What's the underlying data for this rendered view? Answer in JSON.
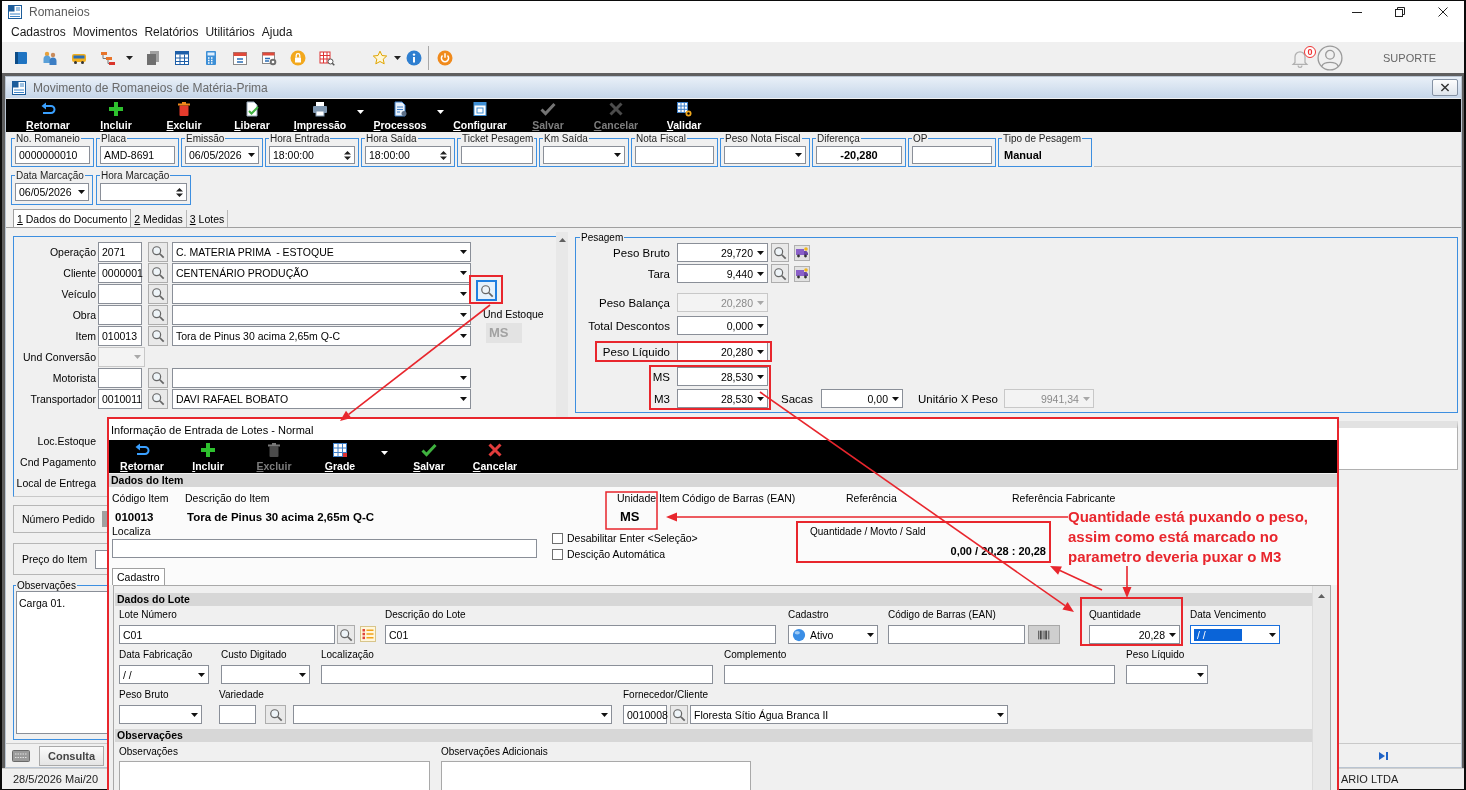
{
  "window": {
    "title": "Romaneios"
  },
  "menu": [
    {
      "label": "Cadastros"
    },
    {
      "label": "Movimentos"
    },
    {
      "label": "Relatórios"
    },
    {
      "label": "Utilitários"
    },
    {
      "label": "Ajuda"
    }
  ],
  "toolbar": {
    "notification_count": "0",
    "user": "SUPORTE"
  },
  "document": {
    "title": "Movimento de Romaneios de Matéria-Prima",
    "actions": [
      {
        "label": "Retornar",
        "disabled": false,
        "has_menu": false
      },
      {
        "label": "Incluir",
        "disabled": false,
        "has_menu": false
      },
      {
        "label": "Excluir",
        "disabled": false,
        "has_menu": false
      },
      {
        "label": "Liberar",
        "disabled": false,
        "has_menu": false
      },
      {
        "label": "Impressão",
        "disabled": false,
        "has_menu": true
      },
      {
        "label": "Processos",
        "disabled": false,
        "has_menu": true
      },
      {
        "label": "Configurar",
        "disabled": false,
        "has_menu": false
      },
      {
        "label": "Salvar",
        "disabled": true,
        "has_menu": false
      },
      {
        "label": "Cancelar",
        "disabled": true,
        "has_menu": false
      },
      {
        "label": "Validar",
        "disabled": false,
        "has_menu": false
      }
    ],
    "header_fields": [
      {
        "label": "No. Romaneio",
        "kind": "text",
        "value": "0000000010"
      },
      {
        "label": "Placa",
        "kind": "text",
        "value": "AMD-8691"
      },
      {
        "label": "Emissão",
        "kind": "combo",
        "value": "06/05/2026"
      },
      {
        "label": "Hora Entrada",
        "kind": "spin",
        "value": "18:00:00"
      },
      {
        "label": "Hora Saída",
        "kind": "spin",
        "value": "18:00:00"
      },
      {
        "label": "Ticket Pesagem",
        "kind": "text"
      },
      {
        "label": "Km Saída",
        "kind": "combo"
      },
      {
        "label": "Nota Fiscal",
        "kind": "text"
      },
      {
        "label": "Peso Nota Fiscal",
        "kind": "combo"
      },
      {
        "label": "Diferença",
        "kind": "readout",
        "value": "-20,280"
      },
      {
        "label": "OP",
        "kind": "text"
      },
      {
        "label": "Tipo de Pesagem",
        "kind": "static",
        "value": "Manual"
      }
    ],
    "marking_fields": [
      {
        "label": "Data Marcação",
        "kind": "combo",
        "value": "06/05/2026"
      },
      {
        "label": "Hora Marcação",
        "kind": "spin"
      }
    ],
    "tabs": [
      {
        "label": "1 Dados do Documento",
        "selected": true
      },
      {
        "label": "2 Medidas",
        "selected": false
      },
      {
        "label": "3 Lotes",
        "selected": false
      }
    ],
    "form_rows": [
      {
        "label": "Operação",
        "kind": "lookup",
        "code": "2071",
        "description": "C. MATERIA PRIMA  - ESTOQUE",
        "disabled": false
      },
      {
        "label": "Cliente",
        "kind": "lookup",
        "code": "0000001",
        "description": "CENTENÁRIO PRODUÇÃO",
        "disabled": false
      },
      {
        "label": "Veículo",
        "kind": "lookup",
        "disabled": false
      },
      {
        "label": "Obra",
        "kind": "lookup",
        "disabled": false
      },
      {
        "label": "Item",
        "kind": "lookup",
        "code": "010013",
        "description": "Tora de Pinus 30 acima 2,65m Q-C",
        "disabled": false
      },
      {
        "label": "Und Conversão",
        "kind": "select",
        "disabled": true
      },
      {
        "label": "Motorista",
        "kind": "lookup",
        "disabled": false
      },
      {
        "label": "Transportador",
        "kind": "lookup",
        "code": "0010011",
        "description": "DAVI RAFAEL BOBATO",
        "disabled": false
      },
      {
        "label": "Loc.Estoque",
        "kind": "label"
      },
      {
        "label": "Cnd Pagamento",
        "kind": "label"
      },
      {
        "label": "Local de Entrega",
        "kind": "label"
      }
    ],
    "stock_unit": {
      "label": "Und Estoque",
      "value": "MS"
    },
    "order_number": {
      "label": "Número Pedido"
    },
    "item_price": {
      "label": "Preço do Item"
    },
    "notes": {
      "label": "Observações",
      "value": "Carga 01."
    },
    "weighing": {
      "title": "Pesagem",
      "rows": [
        {
          "label": "Peso Bruto",
          "value": "29,720",
          "disabled": false,
          "scale_tools": true
        },
        {
          "label": "Tara",
          "value": "9,440",
          "disabled": false,
          "scale_tools": true
        },
        {
          "label": "Peso Balança",
          "value": "20,280",
          "disabled": true,
          "scale_tools": false
        },
        {
          "label": "Total Descontos",
          "value": "0,000",
          "disabled": false,
          "scale_tools": false
        },
        {
          "label": "Peso Líquido",
          "value": "20,280",
          "disabled": false,
          "scale_tools": false
        },
        {
          "label": "MS",
          "value": "28,530",
          "disabled": false,
          "scale_tools": false
        },
        {
          "label": "M3",
          "value": "28,530",
          "disabled": false,
          "scale_tools": false,
          "extras": [
            {
              "label": "Sacas",
              "value": "0,00",
              "disabled": false
            },
            {
              "label": "Unitário X Peso",
              "value": "9941,34",
              "disabled": true
            }
          ]
        }
      ]
    }
  },
  "bottom_tabs": [
    {
      "label": "Consulta"
    }
  ],
  "status_bar": {
    "left": "28/5/2026 Mai/20",
    "right": "ARIO LTDA"
  },
  "dialog": {
    "title": "Informação de Entrada de Lotes - Normal",
    "actions": [
      {
        "label": "Retornar",
        "disabled": false,
        "has_menu": false
      },
      {
        "label": "Incluir",
        "disabled": false,
        "has_menu": false
      },
      {
        "label": "Excluir",
        "disabled": true,
        "has_menu": false
      },
      {
        "label": "Grade",
        "disabled": false,
        "has_menu": true
      },
      {
        "label": "Salvar",
        "disabled": false,
        "has_menu": false
      },
      {
        "label": "Cancelar",
        "disabled": false,
        "has_menu": false
      }
    ],
    "item": {
      "heading": "Dados do Item",
      "columns": [
        {
          "label": "Código Item",
          "value": "010013"
        },
        {
          "label": "Descrição do Item",
          "value": "Tora de Pinus 30 acima 2,65m Q-C"
        },
        {
          "label": "Unidade Item",
          "value": "MS"
        },
        {
          "label": "Código de Barras (EAN)"
        },
        {
          "label": "Referência"
        },
        {
          "label": "Referência Fabricante"
        }
      ],
      "search": {
        "label": "Localiza"
      },
      "options": [
        {
          "label": "Desabilitar Enter <Seleção>",
          "checked": false
        },
        {
          "label": "Descição Automática",
          "checked": false
        }
      ],
      "balance": {
        "label": "Quantidade / Movto / Sald",
        "value": "0,00 / 20,28 : 20,28"
      }
    },
    "tabs": [
      {
        "label": "Cadastro",
        "selected": true
      }
    ],
    "lot": {
      "heading": "Dados do Lote",
      "rows": [
        {
          "fields": [
            {
              "label": "Lote Número",
              "kind": "code",
              "value": "C01",
              "highlighted": false
            },
            {
              "label": "Descrição do Lote",
              "kind": "text",
              "value": "C01",
              "highlighted": false
            },
            {
              "label": "Cadastro",
              "kind": "status",
              "value": "Ativo",
              "highlighted": false
            },
            {
              "label": "Código de Barras (EAN)",
              "kind": "barcode",
              "highlighted": false
            },
            {
              "label": "Quantidade",
              "kind": "number",
              "value": "20,28",
              "highlighted": false
            },
            {
              "label": "Data Vencimento",
              "kind": "date",
              "value": "/ /",
              "highlighted": true
            }
          ]
        },
        {
          "fields": [
            {
              "label": "Data Fabricação",
              "kind": "date",
              "value": "/ /",
              "highlighted": false
            },
            {
              "label": "Custo Digitado",
              "kind": "number",
              "highlighted": false
            },
            {
              "label": "Localização",
              "kind": "text",
              "highlighted": false
            },
            {
              "label": "Complemento",
              "kind": "text",
              "highlighted": false
            },
            {
              "label": "Peso Líquido",
              "kind": "number",
              "highlighted": false
            }
          ]
        },
        {
          "fields": [
            {
              "label": "Peso Bruto",
              "kind": "number",
              "highlighted": false
            },
            {
              "label": "Variedade",
              "kind": "lookup",
              "highlighted": false
            },
            {
              "label": "Fornecedor/Cliente",
              "kind": "lookup",
              "code": "0010008",
              "value": "Floresta Sítio Água Branca II",
              "highlighted": false
            }
          ]
        }
      ]
    },
    "notes": {
      "heading": "Observações",
      "fields": [
        {
          "label": "Observações"
        },
        {
          "label": "Observações Adicionais"
        }
      ]
    }
  },
  "annotation": {
    "text": "Quantidade está puxando o peso, assim como está marcado no parametro deveria puxar o M3"
  }
}
